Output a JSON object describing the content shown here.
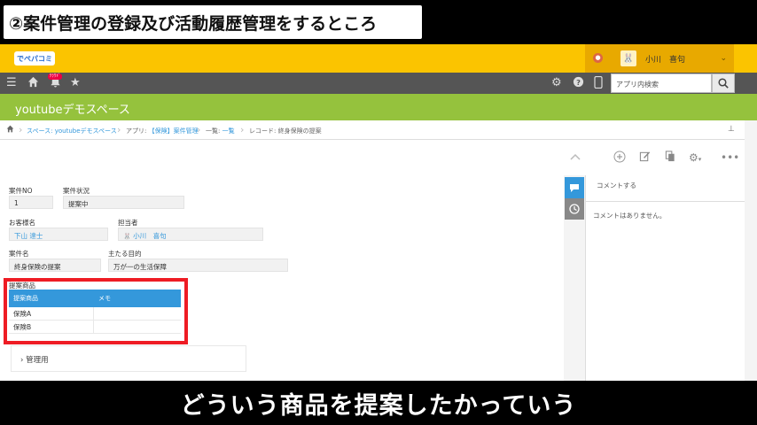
{
  "video": {
    "title": "②案件管理の登録及び活動履歴管理をするところ",
    "subtitle": "どういう商品を提案したかっていう"
  },
  "header": {
    "logo_text": "でぺパコミ",
    "user_name": "小川　喜句",
    "chevron": "⌄"
  },
  "nav": {
    "search_placeholder": "アプリ内検索",
    "bell_badge": "ｸﾗｳﾄﾞ"
  },
  "space": {
    "name": "youtubeデモスペース"
  },
  "breadcrumb": {
    "space": "スペース: youtubeデモスペース",
    "app_prefix": "アプリ: ",
    "app_name": "【保険】案件管理",
    "list_prefix": "一覧: ",
    "list_name": "一覧",
    "record_prefix": "レコード: ",
    "record_name": "終身保険の提案"
  },
  "record": {
    "fields": {
      "case_no": {
        "label": "案件NO",
        "value": "1"
      },
      "case_status": {
        "label": "案件状況",
        "value": "提案中"
      },
      "customer": {
        "label": "お客様名",
        "value": "下山 達士"
      },
      "assignee": {
        "label": "担当者",
        "value": "小川　喜句"
      },
      "case_name": {
        "label": "案件名",
        "value": "終身保険の提案"
      },
      "purpose": {
        "label": "主たる目的",
        "value": "万が一の生活保障"
      }
    },
    "subtable": {
      "label": "提案商品",
      "headers": [
        "提案商品",
        "メモ"
      ],
      "rows": [
        [
          "保険A",
          ""
        ],
        [
          "保険B",
          ""
        ]
      ]
    },
    "group": {
      "label": "管理用"
    }
  },
  "comments": {
    "input_placeholder": "コメントする",
    "empty_text": "コメントはありません。"
  },
  "colors": {
    "header_orange": "#fbc400",
    "nav_gray": "#555555",
    "space_green": "#95c23d",
    "accent_blue": "#3498db",
    "highlight_red": "#ee1c24"
  }
}
